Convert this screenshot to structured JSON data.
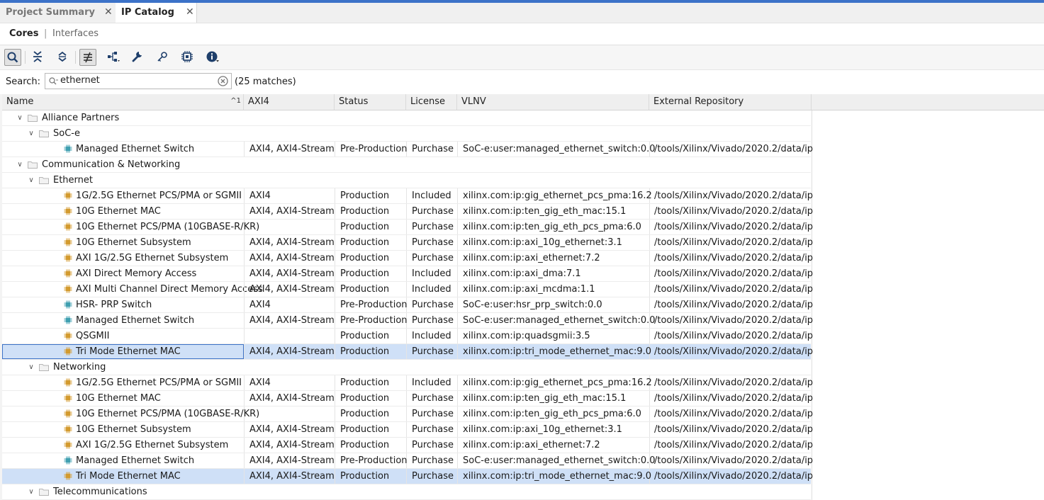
{
  "tabs": [
    {
      "label": "Project Summary",
      "active": false
    },
    {
      "label": "IP Catalog",
      "active": true
    }
  ],
  "subnav": {
    "cores": "Cores",
    "separator": "|",
    "interfaces": "Interfaces"
  },
  "toolbar": {
    "buttons": [
      "search-icon",
      "collapse-all-icon",
      "expand-all-icon",
      "filter-icon",
      "hierarchy-icon",
      "wrench-icon",
      "key-icon",
      "chip-icon",
      "info-icon"
    ]
  },
  "search": {
    "label": "Search:",
    "value": "ethernet",
    "count": "(25 matches)"
  },
  "columns": [
    {
      "label": "Name",
      "sort": "^1"
    },
    {
      "label": "AXI4"
    },
    {
      "label": "Status"
    },
    {
      "label": "License"
    },
    {
      "label": "VLNV"
    },
    {
      "label": "External Repository"
    }
  ],
  "colors": {
    "selection": "#cfe0f7",
    "accent": "#3c72c8",
    "core_orange": "#d39a2e",
    "core_teal": "#3f9fb0"
  },
  "rows": [
    {
      "type": "folder",
      "level": 0,
      "name": "Alliance Partners"
    },
    {
      "type": "folder",
      "level": 1,
      "name": "SoC-e"
    },
    {
      "type": "core",
      "level": 2,
      "icon": "teal",
      "name": "Managed Ethernet Switch",
      "axi4": "AXI4, AXI4-Stream",
      "status": "Pre-Production",
      "license": "Purchase",
      "vlnv": "SoC-e:user:managed_ethernet_switch:0.0",
      "repo": "/tools/Xilinx/Vivado/2020.2/data/ip"
    },
    {
      "type": "folder",
      "level": 0,
      "name": "Communication & Networking"
    },
    {
      "type": "folder",
      "level": 1,
      "name": "Ethernet"
    },
    {
      "type": "core",
      "level": 2,
      "icon": "orange",
      "name": "1G/2.5G Ethernet PCS/PMA or SGMII",
      "axi4": "AXI4",
      "status": "Production",
      "license": "Included",
      "vlnv": "xilinx.com:ip:gig_ethernet_pcs_pma:16.2",
      "repo": "/tools/Xilinx/Vivado/2020.2/data/ip"
    },
    {
      "type": "core",
      "level": 2,
      "icon": "orange",
      "name": "10G Ethernet MAC",
      "axi4": "AXI4, AXI4-Stream",
      "status": "Production",
      "license": "Purchase",
      "vlnv": "xilinx.com:ip:ten_gig_eth_mac:15.1",
      "repo": "/tools/Xilinx/Vivado/2020.2/data/ip"
    },
    {
      "type": "core",
      "level": 2,
      "icon": "orange",
      "name": "10G Ethernet PCS/PMA (10GBASE-R/KR)",
      "axi4": "",
      "status": "Production",
      "license": "Purchase",
      "vlnv": "xilinx.com:ip:ten_gig_eth_pcs_pma:6.0",
      "repo": "/tools/Xilinx/Vivado/2020.2/data/ip"
    },
    {
      "type": "core",
      "level": 2,
      "icon": "orange",
      "name": "10G Ethernet Subsystem",
      "axi4": "AXI4, AXI4-Stream",
      "status": "Production",
      "license": "Purchase",
      "vlnv": "xilinx.com:ip:axi_10g_ethernet:3.1",
      "repo": "/tools/Xilinx/Vivado/2020.2/data/ip"
    },
    {
      "type": "core",
      "level": 2,
      "icon": "orange",
      "name": "AXI 1G/2.5G Ethernet Subsystem",
      "axi4": "AXI4, AXI4-Stream",
      "status": "Production",
      "license": "Purchase",
      "vlnv": "xilinx.com:ip:axi_ethernet:7.2",
      "repo": "/tools/Xilinx/Vivado/2020.2/data/ip"
    },
    {
      "type": "core",
      "level": 2,
      "icon": "orange",
      "name": "AXI Direct Memory Access",
      "axi4": "AXI4, AXI4-Stream",
      "status": "Production",
      "license": "Included",
      "vlnv": "xilinx.com:ip:axi_dma:7.1",
      "repo": "/tools/Xilinx/Vivado/2020.2/data/ip"
    },
    {
      "type": "core",
      "level": 2,
      "icon": "orange",
      "name": "AXI Multi Channel Direct Memory Access",
      "axi4": "AXI4, AXI4-Stream",
      "status": "Production",
      "license": "Included",
      "vlnv": "xilinx.com:ip:axi_mcdma:1.1",
      "repo": "/tools/Xilinx/Vivado/2020.2/data/ip"
    },
    {
      "type": "core",
      "level": 2,
      "icon": "teal",
      "name": "HSR- PRP Switch",
      "axi4": "AXI4",
      "status": "Pre-Production",
      "license": "Purchase",
      "vlnv": "SoC-e:user:hsr_prp_switch:0.0",
      "repo": "/tools/Xilinx/Vivado/2020.2/data/ip"
    },
    {
      "type": "core",
      "level": 2,
      "icon": "teal",
      "name": "Managed Ethernet Switch",
      "axi4": "AXI4, AXI4-Stream",
      "status": "Pre-Production",
      "license": "Purchase",
      "vlnv": "SoC-e:user:managed_ethernet_switch:0.0",
      "repo": "/tools/Xilinx/Vivado/2020.2/data/ip"
    },
    {
      "type": "core",
      "level": 2,
      "icon": "orange",
      "name": "QSGMII",
      "axi4": "",
      "status": "Production",
      "license": "Included",
      "vlnv": "xilinx.com:ip:quadsgmii:3.5",
      "repo": "/tools/Xilinx/Vivado/2020.2/data/ip"
    },
    {
      "type": "core",
      "level": 2,
      "icon": "orange",
      "name": "Tri Mode Ethernet MAC",
      "axi4": "AXI4, AXI4-Stream",
      "status": "Production",
      "license": "Purchase",
      "vlnv": "xilinx.com:ip:tri_mode_ethernet_mac:9.0",
      "repo": "/tools/Xilinx/Vivado/2020.2/data/ip",
      "selected": true,
      "current": true
    },
    {
      "type": "folder",
      "level": 1,
      "name": "Networking"
    },
    {
      "type": "core",
      "level": 2,
      "icon": "orange",
      "name": "1G/2.5G Ethernet PCS/PMA or SGMII",
      "axi4": "AXI4",
      "status": "Production",
      "license": "Included",
      "vlnv": "xilinx.com:ip:gig_ethernet_pcs_pma:16.2",
      "repo": "/tools/Xilinx/Vivado/2020.2/data/ip"
    },
    {
      "type": "core",
      "level": 2,
      "icon": "orange",
      "name": "10G Ethernet MAC",
      "axi4": "AXI4, AXI4-Stream",
      "status": "Production",
      "license": "Purchase",
      "vlnv": "xilinx.com:ip:ten_gig_eth_mac:15.1",
      "repo": "/tools/Xilinx/Vivado/2020.2/data/ip"
    },
    {
      "type": "core",
      "level": 2,
      "icon": "orange",
      "name": "10G Ethernet PCS/PMA (10GBASE-R/KR)",
      "axi4": "",
      "status": "Production",
      "license": "Purchase",
      "vlnv": "xilinx.com:ip:ten_gig_eth_pcs_pma:6.0",
      "repo": "/tools/Xilinx/Vivado/2020.2/data/ip"
    },
    {
      "type": "core",
      "level": 2,
      "icon": "orange",
      "name": "10G Ethernet Subsystem",
      "axi4": "AXI4, AXI4-Stream",
      "status": "Production",
      "license": "Purchase",
      "vlnv": "xilinx.com:ip:axi_10g_ethernet:3.1",
      "repo": "/tools/Xilinx/Vivado/2020.2/data/ip"
    },
    {
      "type": "core",
      "level": 2,
      "icon": "orange",
      "name": "AXI 1G/2.5G Ethernet Subsystem",
      "axi4": "AXI4, AXI4-Stream",
      "status": "Production",
      "license": "Purchase",
      "vlnv": "xilinx.com:ip:axi_ethernet:7.2",
      "repo": "/tools/Xilinx/Vivado/2020.2/data/ip"
    },
    {
      "type": "core",
      "level": 2,
      "icon": "teal",
      "name": "Managed Ethernet Switch",
      "axi4": "AXI4, AXI4-Stream",
      "status": "Pre-Production",
      "license": "Purchase",
      "vlnv": "SoC-e:user:managed_ethernet_switch:0.0",
      "repo": "/tools/Xilinx/Vivado/2020.2/data/ip"
    },
    {
      "type": "core",
      "level": 2,
      "icon": "orange",
      "name": "Tri Mode Ethernet MAC",
      "axi4": "AXI4, AXI4-Stream",
      "status": "Production",
      "license": "Purchase",
      "vlnv": "xilinx.com:ip:tri_mode_ethernet_mac:9.0",
      "repo": "/tools/Xilinx/Vivado/2020.2/data/ip",
      "selected": true
    },
    {
      "type": "folder",
      "level": 1,
      "name": "Telecommunications"
    }
  ]
}
